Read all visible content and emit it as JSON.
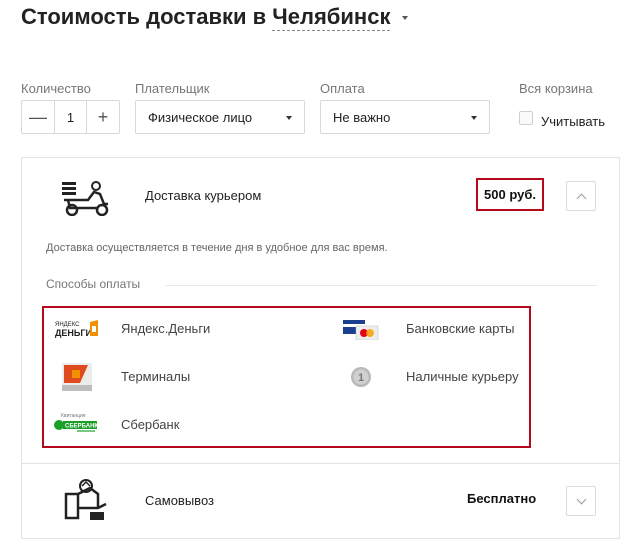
{
  "header": {
    "title_prefix": "Стоимость доставки в",
    "city": "Челябинск"
  },
  "filters": {
    "quantity_label": "Количество",
    "quantity_value": "1",
    "minus": "—",
    "plus": "+",
    "payer_label": "Плательщик",
    "payer_value": "Физическое лицо",
    "payment_label": "Оплата",
    "payment_value": "Не важно",
    "cart_label": "Вся корзина",
    "cart_checkbox_label": "Учитывать"
  },
  "courier": {
    "name": "Доставка курьером",
    "price": "500 руб.",
    "note": "Доставка осуществляется в течение дня в удобное для вас время.",
    "payment_methods_label": "Способы оплаты",
    "methods": [
      {
        "label": "Яндекс.Деньги",
        "icon": "yandex-money-icon"
      },
      {
        "label": "Банковские карты",
        "icon": "bank-cards-icon"
      },
      {
        "label": "Терминалы",
        "icon": "terminal-icon"
      },
      {
        "label": "Наличные курьеру",
        "icon": "cash-coin-icon"
      },
      {
        "label": "Сбербанк",
        "icon": "sberbank-icon"
      }
    ]
  },
  "pickup": {
    "name": "Самовывоз",
    "price": "Бесплатно"
  },
  "colors": {
    "highlight": "#b40a1b",
    "yandex_orange": "#f29100",
    "sber_green": "#1a9f29"
  }
}
